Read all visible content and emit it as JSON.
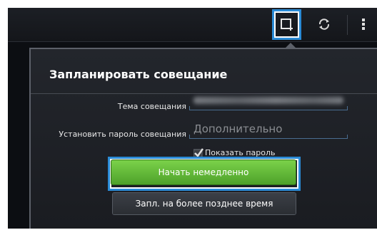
{
  "action_bar": {
    "icons": [
      "new-meeting-icon",
      "refresh-icon",
      "overflow-menu-icon"
    ]
  },
  "dialog": {
    "title": "Запланировать совещание",
    "topic_label": "Тема совещания",
    "password_label": "Установить пароль совещания",
    "password_placeholder": "Дополнительно",
    "show_password_label": "Показать пароль",
    "show_password_checked": true,
    "start_now_label": "Начать немедленно",
    "schedule_later_label": "Запл. на более позднее время"
  },
  "colors": {
    "highlight": "#2a8bd6",
    "start_button": "#5fb534",
    "field_underline": "#4a6d91"
  }
}
